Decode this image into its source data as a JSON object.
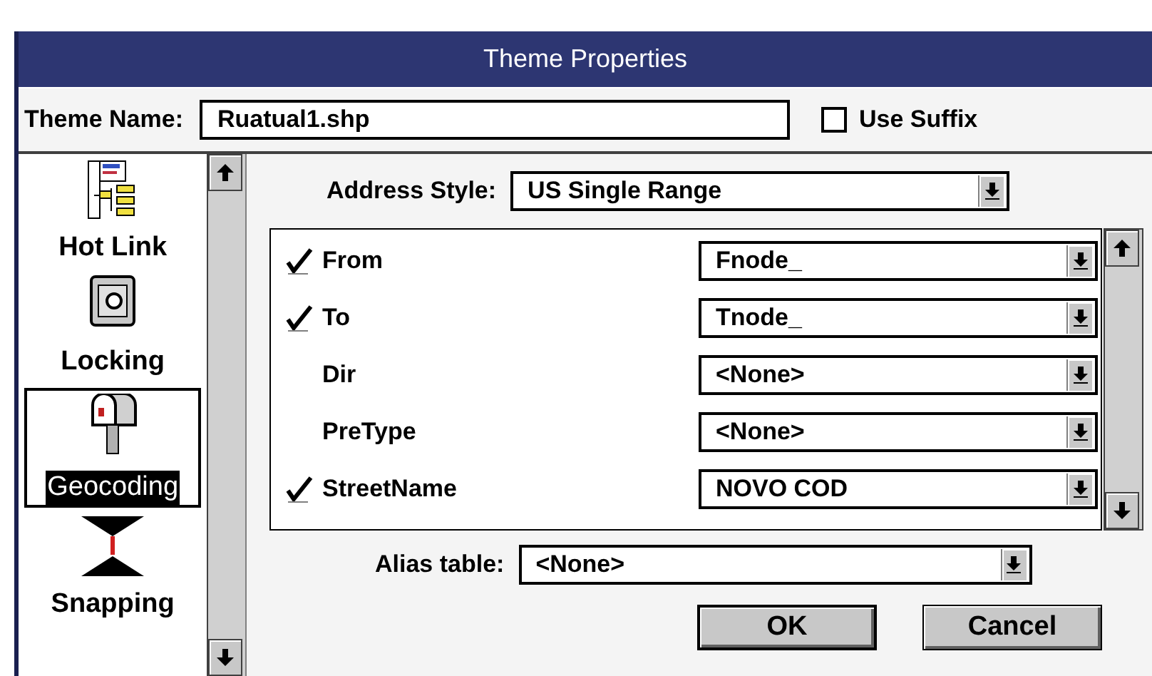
{
  "window": {
    "title": "Theme Properties"
  },
  "theme_name": {
    "label": "Theme Name:",
    "value": "Ruatual1.shp"
  },
  "use_suffix": {
    "label": "Use Suffix",
    "checked": false
  },
  "sidebar": {
    "items": [
      {
        "label": "Hot Link",
        "kind": "hotlink",
        "selected": false
      },
      {
        "label": "Locking",
        "kind": "locking",
        "selected": false
      },
      {
        "label": "Geocoding",
        "kind": "geocoding",
        "selected": true
      },
      {
        "label": "Snapping",
        "kind": "snapping",
        "selected": false
      }
    ]
  },
  "address_style": {
    "label": "Address Style:",
    "value": "US Single Range"
  },
  "fields": [
    {
      "name": "From",
      "checked": true,
      "value": "Fnode_"
    },
    {
      "name": "To",
      "checked": true,
      "value": "Tnode_"
    },
    {
      "name": "Dir",
      "checked": false,
      "value": "<None>"
    },
    {
      "name": "PreType",
      "checked": false,
      "value": "<None>"
    },
    {
      "name": "StreetName",
      "checked": true,
      "value": "NOVO COD"
    }
  ],
  "alias_table": {
    "label": "Alias table:",
    "value": "<None>"
  },
  "buttons": [
    "OK",
    "Cancel"
  ]
}
